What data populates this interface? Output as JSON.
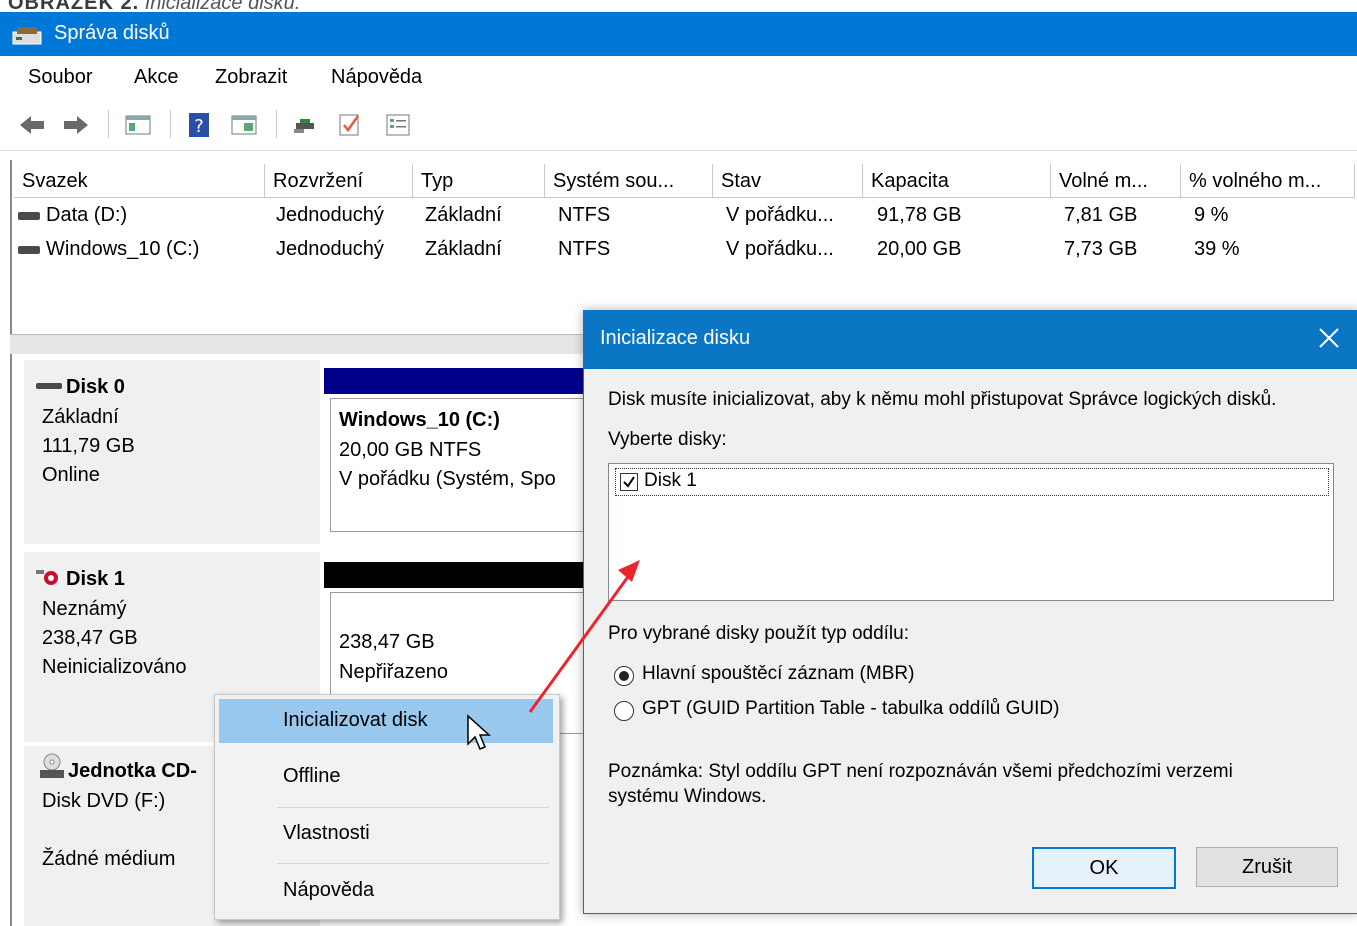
{
  "caption": {
    "prefix": "OBRÁZEK 2.",
    "text": "Inicializace disku."
  },
  "window": {
    "title": "Správa disků"
  },
  "menu": [
    "Soubor",
    "Akce",
    "Zobrazit",
    "Nápověda"
  ],
  "toolbar_icons": [
    "back-arrow-icon",
    "forward-arrow-icon",
    "console-tree-icon",
    "help-icon",
    "show-pane-icon",
    "rescan-icon",
    "check-icon",
    "properties-icon"
  ],
  "volumes": {
    "columns": [
      "Svazek",
      "Rozvržení",
      "Typ",
      "Systém sou...",
      "Stav",
      "Kapacita",
      "Volné m...",
      "% volného m..."
    ],
    "rows": [
      [
        "Data (D:)",
        "Jednoduchý",
        "Základní",
        "NTFS",
        "V pořádku...",
        "91,78 GB",
        "7,81 GB",
        "9 %"
      ],
      [
        "Windows_10 (C:)",
        "Jednoduchý",
        "Základní",
        "NTFS",
        "V pořádku...",
        "20,00 GB",
        "7,73 GB",
        "39 %"
      ]
    ]
  },
  "disks": [
    {
      "name": "Disk 0",
      "type": "Základní",
      "size": "111,79 GB",
      "status": "Online",
      "partition": {
        "name": "Windows_10  (C:)",
        "size": "20,00 GB NTFS",
        "status": "V pořádku (Systém, Spo"
      }
    },
    {
      "name": "Disk 1",
      "type": "Neznámý",
      "size": "238,47 GB",
      "status": "Neinicializováno",
      "partition": {
        "size": "238,47 GB",
        "status": "Nepřiřazeno"
      }
    },
    {
      "name": "Jednotka CD-",
      "type": "Disk DVD (F:)",
      "status": "Žádné médium"
    }
  ],
  "context_menu": [
    "Inicializovat disk",
    "Offline",
    "Vlastnosti",
    "Nápověda"
  ],
  "dialog": {
    "title": "Inicializace disku",
    "intro": "Disk musíte inicializovat, aby k němu mohl přistupovat Správce logických disků.",
    "select_label": "Vyberte disky:",
    "disk_item": "Disk 1",
    "partition_label": "Pro vybrané disky použít typ oddílu:",
    "options": [
      "Hlavní spouštěcí záznam (MBR)",
      "GPT (GUID Partition Table - tabulka oddílů GUID)"
    ],
    "selected_option": 0,
    "note_line1": "Poznámka: Styl oddílu GPT není rozpoznáván všemi předchozími verzemi",
    "note_line2": "systému Windows.",
    "ok": "OK",
    "cancel": "Zrušit"
  },
  "colors": {
    "titlebar": "#0078d7",
    "dialog_title": "#0a76c4",
    "primary_bar": "#00008b",
    "unallocated_bar": "#000000",
    "menu_highlight": "#99c8ee",
    "annotation_arrow": "#e8262b"
  }
}
